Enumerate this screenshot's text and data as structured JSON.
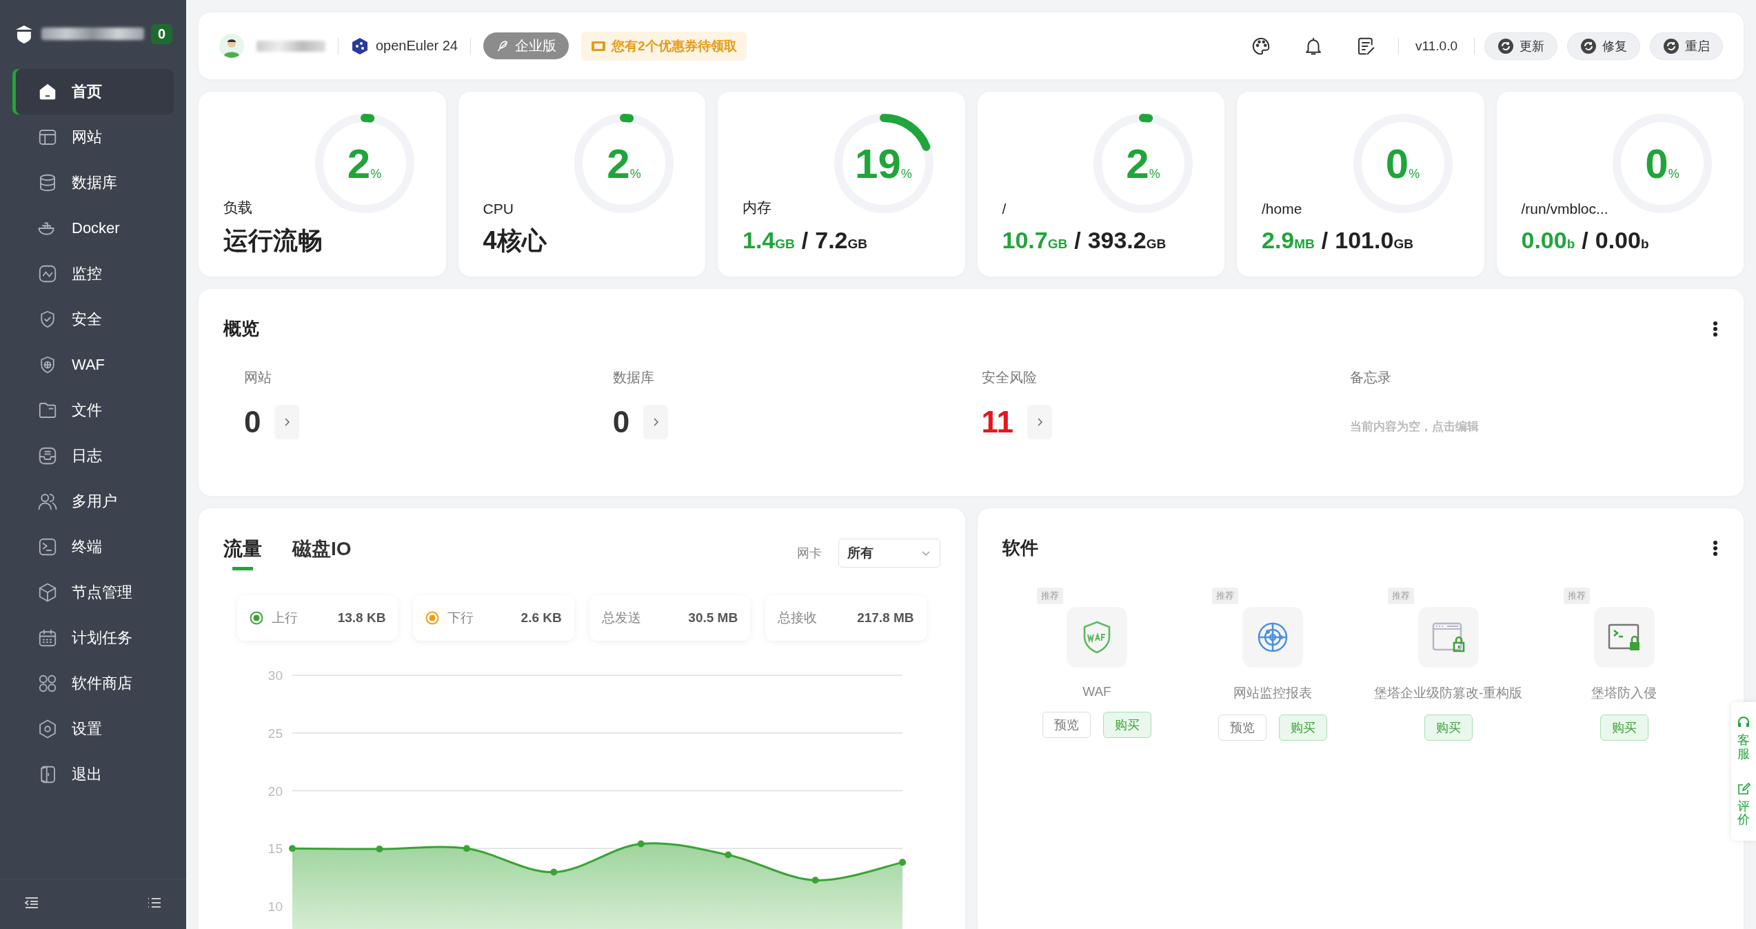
{
  "sidebar": {
    "badge": "0",
    "items": [
      {
        "label": "首页",
        "selected": true
      },
      {
        "label": "网站",
        "selected": false
      },
      {
        "label": "数据库",
        "selected": false
      },
      {
        "label": "Docker",
        "selected": false
      },
      {
        "label": "监控",
        "selected": false
      },
      {
        "label": "安全",
        "selected": false
      },
      {
        "label": "WAF",
        "selected": false
      },
      {
        "label": "文件",
        "selected": false
      },
      {
        "label": "日志",
        "selected": false
      },
      {
        "label": "多用户",
        "selected": false
      },
      {
        "label": "终端",
        "selected": false
      },
      {
        "label": "节点管理",
        "selected": false
      },
      {
        "label": "计划任务",
        "selected": false
      },
      {
        "label": "软件商店",
        "selected": false
      },
      {
        "label": "设置",
        "selected": false
      },
      {
        "label": "退出",
        "selected": false
      }
    ]
  },
  "header": {
    "os": "openEuler 24",
    "edition": "企业版",
    "coupon": "您有2个优惠券待领取",
    "version": "v11.0.0",
    "buttons": [
      "更新",
      "修复",
      "重启"
    ]
  },
  "stats": [
    {
      "kind": "status",
      "label": "负载",
      "percent": "2",
      "unit": "%",
      "level": 0.02,
      "value": "运行流畅"
    },
    {
      "kind": "status",
      "label": "CPU",
      "percent": "2",
      "unit": "%",
      "level": 0.02,
      "value": "4核心"
    },
    {
      "kind": "usage",
      "label": "内存",
      "percent": "19",
      "unit": "%",
      "level": 0.19,
      "used": "1.4",
      "used_unit": "GB",
      "separator": "/",
      "total": "7.2",
      "total_unit": "GB"
    },
    {
      "kind": "usage",
      "label": "/",
      "percent": "2",
      "unit": "%",
      "level": 0.02,
      "used": "10.7",
      "used_unit": "GB",
      "separator": "/",
      "total": "393.2",
      "total_unit": "GB"
    },
    {
      "kind": "usage",
      "label": "/home",
      "percent": "0",
      "unit": "%",
      "level": 0,
      "used": "2.9",
      "used_unit": "MB",
      "separator": "/",
      "total": "101.0",
      "total_unit": "GB"
    },
    {
      "kind": "usage",
      "label": "/run/vmbloc...",
      "percent": "0",
      "unit": "%",
      "level": 0,
      "used": "0.00",
      "used_unit": "b",
      "separator": "/",
      "total": "0.00",
      "total_unit": "b"
    }
  ],
  "overview": {
    "title": "概览",
    "items": [
      {
        "kind": "count",
        "label": "网站",
        "value": "0",
        "alert": false
      },
      {
        "kind": "count",
        "label": "数据库",
        "value": "0",
        "alert": false
      },
      {
        "kind": "count",
        "label": "安全风险",
        "value": "11",
        "alert": true
      },
      {
        "kind": "memo",
        "label": "备忘录",
        "value": "当前内容为空，点击编辑"
      }
    ]
  },
  "traffic": {
    "tabs": [
      {
        "label": "流量",
        "selected": true
      },
      {
        "label": "磁盘IO",
        "selected": false
      }
    ],
    "nic_label": "网卡",
    "nic_value": "所有",
    "legend": [
      {
        "kind": "series",
        "label": "上行",
        "value": "13.8 KB",
        "color": "#3aa335"
      },
      {
        "kind": "series",
        "label": "下行",
        "value": "2.6 KB",
        "color": "#f39c12"
      },
      {
        "kind": "total",
        "label": "总发送",
        "value": "30.5 MB"
      },
      {
        "kind": "total",
        "label": "总接收",
        "value": "217.8 MB"
      }
    ],
    "chart_data": {
      "type": "area",
      "values": [
        15.0,
        14.95,
        15.0,
        12.95,
        15.4,
        14.45,
        12.25,
        13.8
      ],
      "ylim": [
        10,
        30
      ],
      "grid": true,
      "yticks": [
        10,
        15,
        20,
        25,
        30
      ]
    }
  },
  "software": {
    "title": "软件",
    "items": [
      {
        "tag": "推荐",
        "name": "WAF",
        "buttons": [
          {
            "kind": "preview",
            "label": "预览"
          },
          {
            "kind": "buy",
            "label": "购买"
          }
        ]
      },
      {
        "tag": "推荐",
        "name": "网站监控报表",
        "buttons": [
          {
            "kind": "preview",
            "label": "预览"
          },
          {
            "kind": "buy",
            "label": "购买"
          }
        ]
      },
      {
        "tag": "推荐",
        "name": "堡塔企业级防篡改-重构版",
        "buttons": [
          {
            "kind": "buy",
            "label": "购买"
          }
        ]
      },
      {
        "tag": "推荐",
        "name": "堡塔防入侵",
        "buttons": [
          {
            "kind": "buy",
            "label": "购买"
          }
        ]
      }
    ]
  },
  "float_tabs": [
    "客服",
    "评价"
  ]
}
